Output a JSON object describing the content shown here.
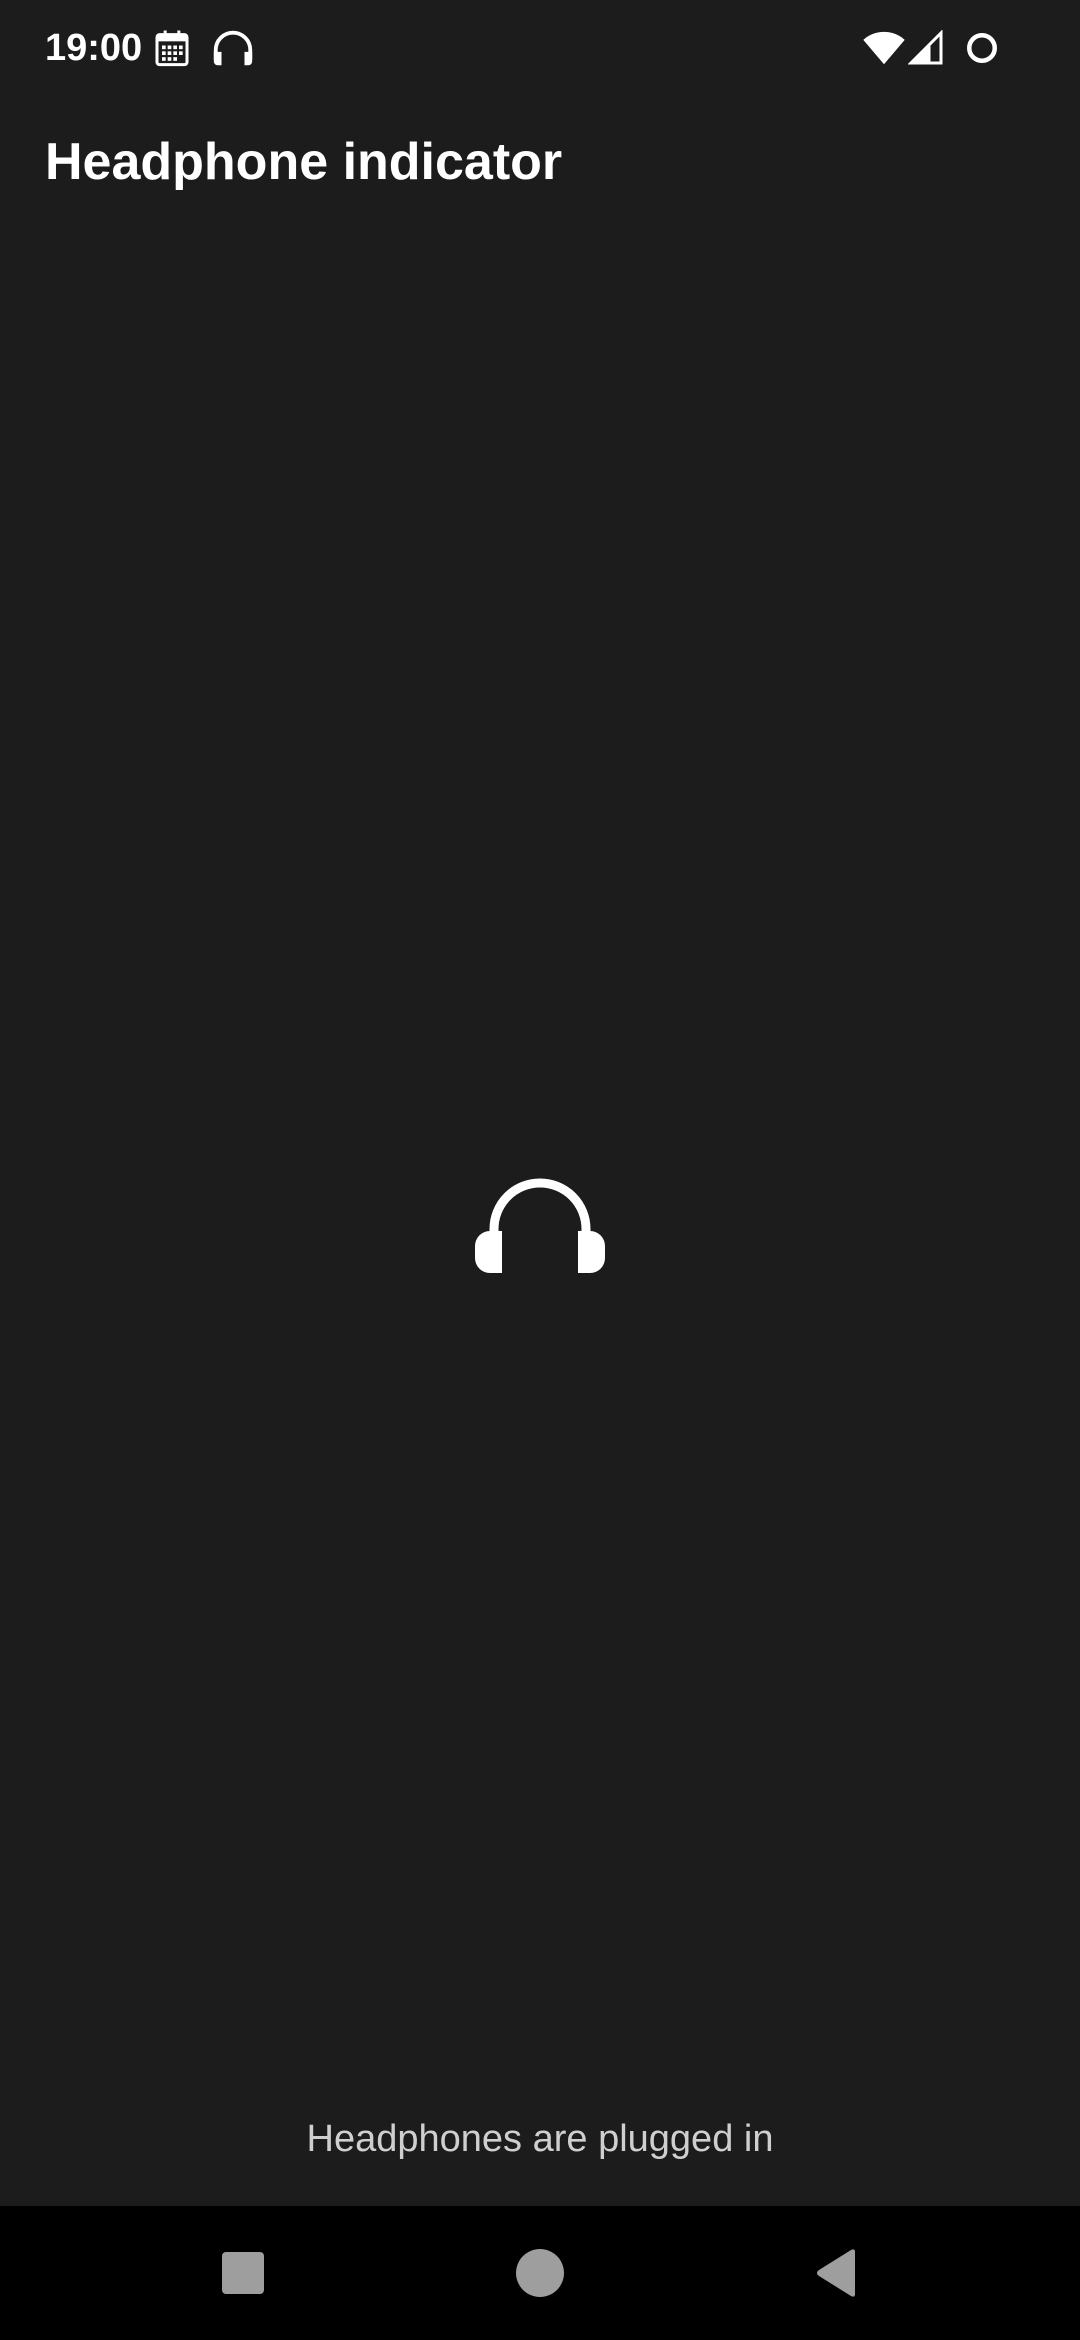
{
  "status_bar": {
    "time": "19:00",
    "icons": [
      "calendar-icon",
      "headset-icon",
      "wifi-icon",
      "cell-signal-icon",
      "battery-saver-icon"
    ]
  },
  "app": {
    "title": "Headphone indicator"
  },
  "main": {
    "icon": "headphones-icon",
    "message": "Headphones are plugged in"
  },
  "nav_bar": {
    "buttons": [
      "recents-button",
      "home-button",
      "back-button"
    ],
    "color": "#9e9e9e"
  },
  "colors": {
    "background": "#1c1c1c",
    "nav_background": "#000000",
    "text_primary": "#ffffff",
    "text_secondary": "#cfcfcf"
  }
}
